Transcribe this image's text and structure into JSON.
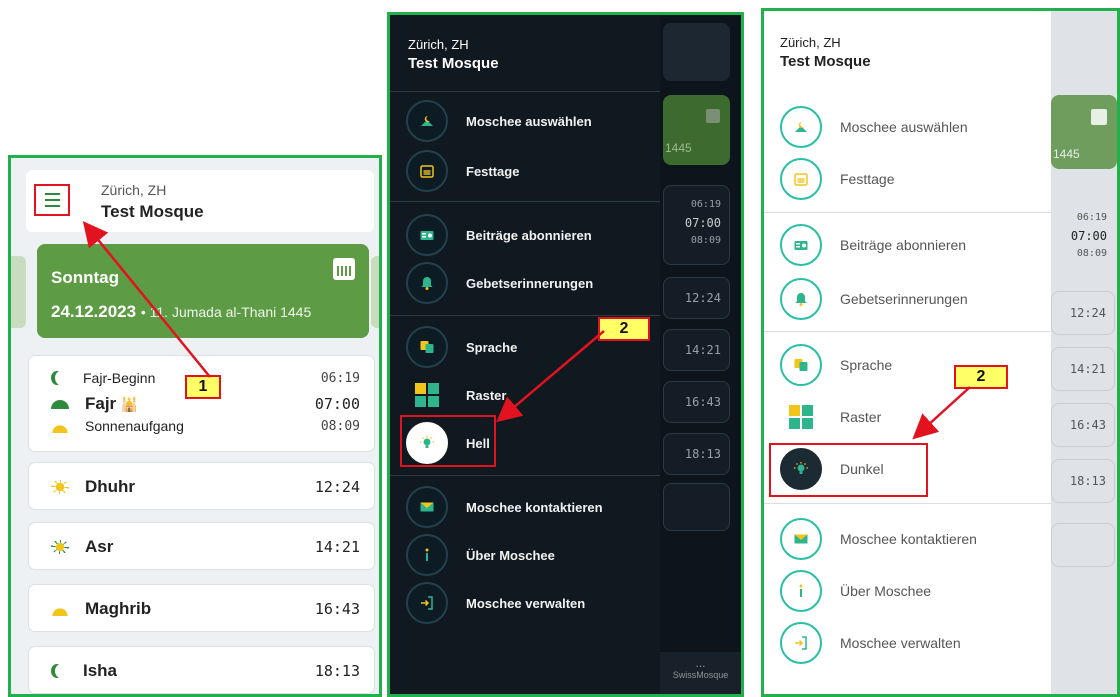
{
  "location": {
    "city": "Zürich, ZH",
    "mosque": "Test Mosque"
  },
  "home": {
    "day": "Sonntag",
    "date": "24.12.2023",
    "hijri": "11. Jumada al-Thani 1445",
    "prayers_fajr": [
      {
        "name": "Fajr-Beginn",
        "time": "06:19"
      },
      {
        "name": "Fajr",
        "time": "07:00"
      },
      {
        "name": "Sonnenaufgang",
        "time": "08:09"
      }
    ],
    "prayers": [
      {
        "name": "Dhuhr",
        "time": "12:24"
      },
      {
        "name": "Asr",
        "time": "14:21"
      },
      {
        "name": "Maghrib",
        "time": "16:43"
      },
      {
        "name": "Isha",
        "time": "18:13"
      }
    ]
  },
  "menu": {
    "items": [
      {
        "label": "Moschee auswählen",
        "icon": "mosque-icon"
      },
      {
        "label": "Festtage",
        "icon": "calendar-icon"
      },
      {
        "label": "Beiträge abonnieren",
        "icon": "subscription-icon"
      },
      {
        "label": "Gebetserinnerungen",
        "icon": "bell-icon"
      },
      {
        "label": "Sprache",
        "icon": "translate-icon"
      },
      {
        "label": "Raster",
        "icon": "grid-icon"
      },
      {
        "label": "Moschee kontaktieren",
        "icon": "mail-icon"
      },
      {
        "label": "Über Moschee",
        "icon": "info-icon"
      },
      {
        "label": "Moschee verwalten",
        "icon": "login-icon"
      }
    ],
    "theme_dark_label": "Hell",
    "theme_light_label": "Dunkel"
  },
  "behind": {
    "year_fragment": "1445",
    "times_fajr": [
      "06:19",
      "07:00",
      "08:09"
    ],
    "times": [
      "12:24",
      "14:21",
      "16:43",
      "18:13"
    ],
    "bottom_nav_more": "...",
    "bottom_nav_label": "SwissMosque"
  },
  "annotations": {
    "badge1": "1",
    "badge2": "2"
  },
  "colors": {
    "highlight": "#e3121f",
    "frame": "#21b04b",
    "accent": "#5d9b45",
    "teal": "#28bfa5"
  }
}
